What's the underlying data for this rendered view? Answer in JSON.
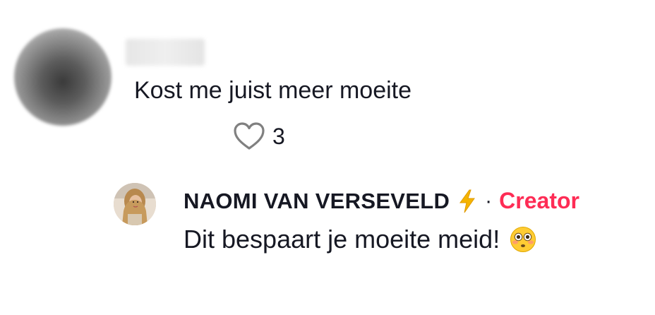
{
  "comment": {
    "text": "Kost me juist meer moeite",
    "likes": "3",
    "icons": {
      "like": "heart-outline-icon"
    }
  },
  "reply": {
    "author": "NAOMI VAN VERSEVELD",
    "separator": "·",
    "badge": "Creator",
    "text": "Dit bespaart je moeite meid!",
    "icons": {
      "after_name": "lightning-bolt-icon",
      "emoji": "flushed-face-emoji"
    }
  },
  "colors": {
    "text": "#161823",
    "creator_badge": "#fe2c55",
    "bolt": "#f5b400"
  }
}
